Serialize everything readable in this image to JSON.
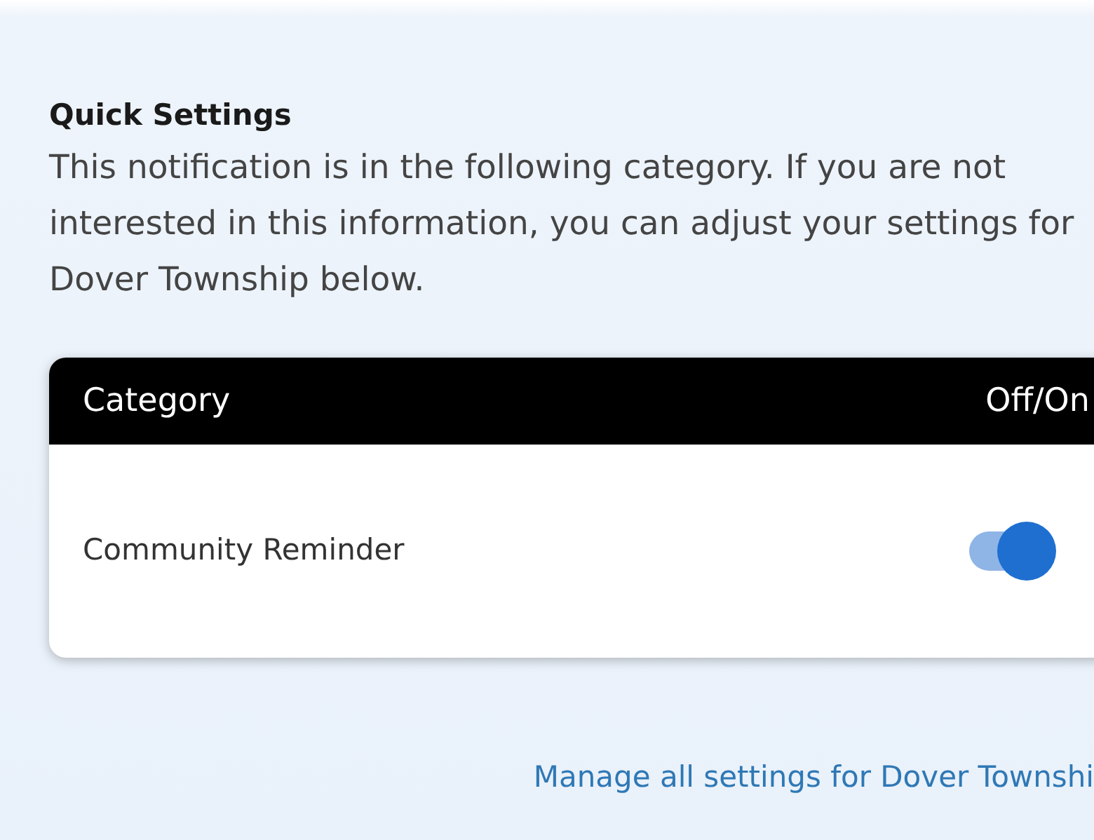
{
  "title": "Quick Settings",
  "description": "This notification is in the following category. If you are not interested in this information, you can adjust your settings for Dover Township below.",
  "table": {
    "columns": [
      "Category",
      "Off/On"
    ],
    "rows": [
      {
        "label": "Community Reminder",
        "on": true
      }
    ]
  },
  "link": "Manage all settings for Dover Townshi"
}
